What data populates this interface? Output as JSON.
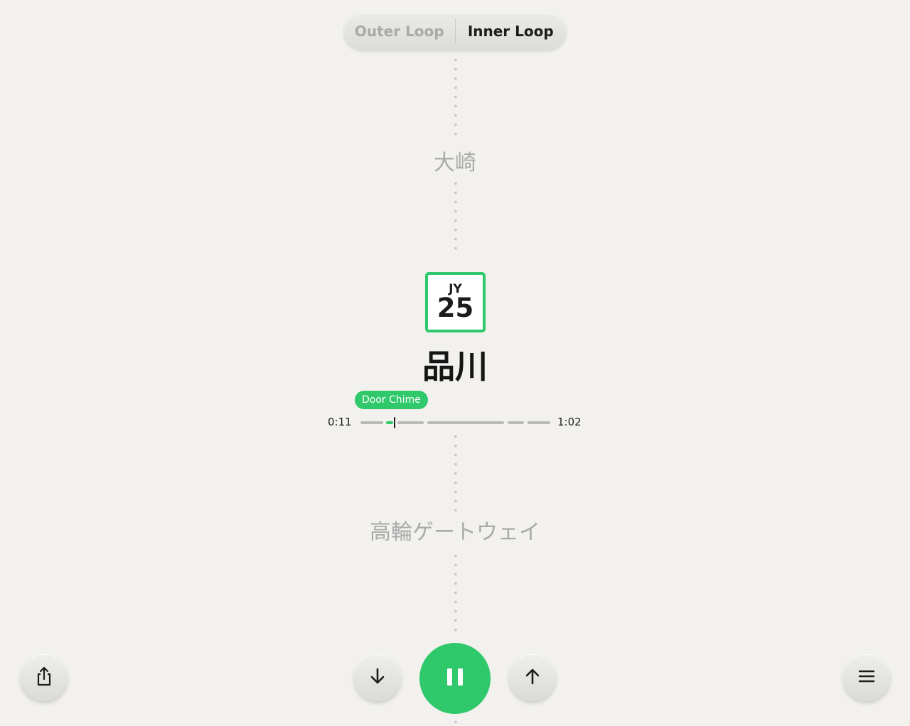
{
  "direction_toggle": {
    "options": [
      "Outer Loop",
      "Inner Loop"
    ],
    "selected": "Inner Loop"
  },
  "stations": {
    "previous": "大崎",
    "current": {
      "line_code": "JY",
      "number": "25",
      "name": "品川"
    },
    "next": "高輪ゲートウェイ"
  },
  "audio": {
    "track_label": "Door Chime",
    "elapsed": "0:11",
    "duration": "1:02",
    "progress_fraction": 0.18
  },
  "controls": {
    "share_icon": "share-icon",
    "previous_icon": "arrow-down-icon",
    "play_state_icon": "pause-icon",
    "next_icon": "arrow-up-icon",
    "menu_icon": "menu-icon"
  },
  "colors": {
    "accent": "#2fc86a",
    "background": "#f2f1ee",
    "faded_text": "#aaaaaa"
  }
}
